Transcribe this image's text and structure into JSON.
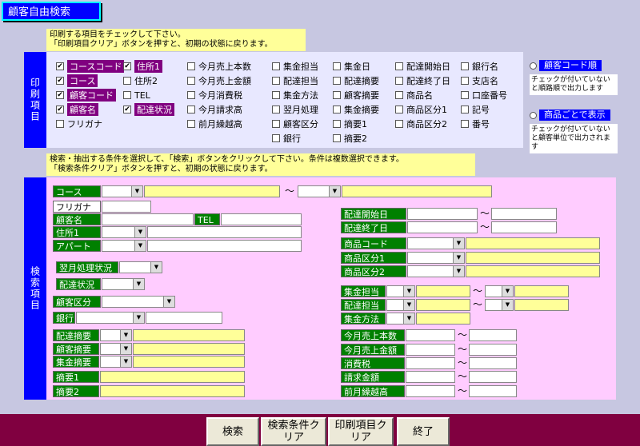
{
  "title": "顧客自由検索",
  "print_note1": "印刷する項目をチェックして下さい。",
  "print_note2": "「印刷項目クリア」ボタンを押すと、初期の状態に戻ります。",
  "print_side": "印刷項目",
  "search_side": "検索項目",
  "search_note1": "検索・抽出する条件を選択して、「検索」ボタンをクリックして下さい。条件は複数選択できます。",
  "search_note2": "「検索条件クリア」ボタンを押すと、初期の状態に戻ります。",
  "print_items": {
    "c1": [
      "コースコード",
      "コース",
      "顧客コード",
      "顧客名",
      "フリガナ"
    ],
    "c2": [
      "住所1",
      "住所2",
      "TEL",
      "配達状況"
    ],
    "c3": [
      "今月売上本数",
      "今月売上金額",
      "今月消費税",
      "今月請求高",
      "前月繰越高"
    ],
    "c4": [
      "集金担当",
      "配達担当",
      "集金方法",
      "翌月処理",
      "顧客区分",
      "銀行"
    ],
    "c5": [
      "集金日",
      "配達摘要",
      "顧客摘要",
      "集金摘要",
      "摘要1",
      "摘要2"
    ],
    "c6": [
      "配達開始日",
      "配達終了日",
      "商品名",
      "商品区分1",
      "商品区分2"
    ],
    "c7": [
      "銀行名",
      "支店名",
      "口座番号",
      "記号",
      "番号"
    ]
  },
  "order": {
    "opt1": "顧客コード順",
    "note1": "チェックが付いていないと順路順で出力します",
    "opt2": "商品ごとで表示",
    "note2": "チェックが付いていないと顧客単位で出力されます"
  },
  "fields": {
    "course": "コース",
    "furigana": "フリガナ",
    "kokyakumei": "顧客名",
    "tel": "TEL",
    "jusho1": "住所1",
    "apart": "アパート",
    "yokugetsu": "翌月処理状況",
    "haitatsu": "配達状況",
    "kubun": "顧客区分",
    "ginko": "銀行",
    "haitatsu_tekiyo": "配達摘要",
    "kokyaku_tekiyo": "顧客摘要",
    "shukin_tekiyo": "集金摘要",
    "tekiyo1": "摘要1",
    "tekiyo2": "摘要2",
    "start": "配達開始日",
    "end": "配達終了日",
    "shohin_code": "商品コード",
    "shohin_k1": "商品区分1",
    "shohin_k2": "商品区分2",
    "shukin_tanto": "集金担当",
    "haitatsu_tanto": "配達担当",
    "shukin_hoho": "集金方法",
    "hon": "今月売上本数",
    "kingaku": "今月売上金額",
    "shohizei": "消費税",
    "seikyu": "請求金額",
    "kurikoshi": "前月繰越高",
    "tilde": "～"
  },
  "buttons": {
    "search": "検索",
    "clear_search": "検索条件クリア",
    "clear_print": "印刷項目クリア",
    "exit": "終了"
  }
}
